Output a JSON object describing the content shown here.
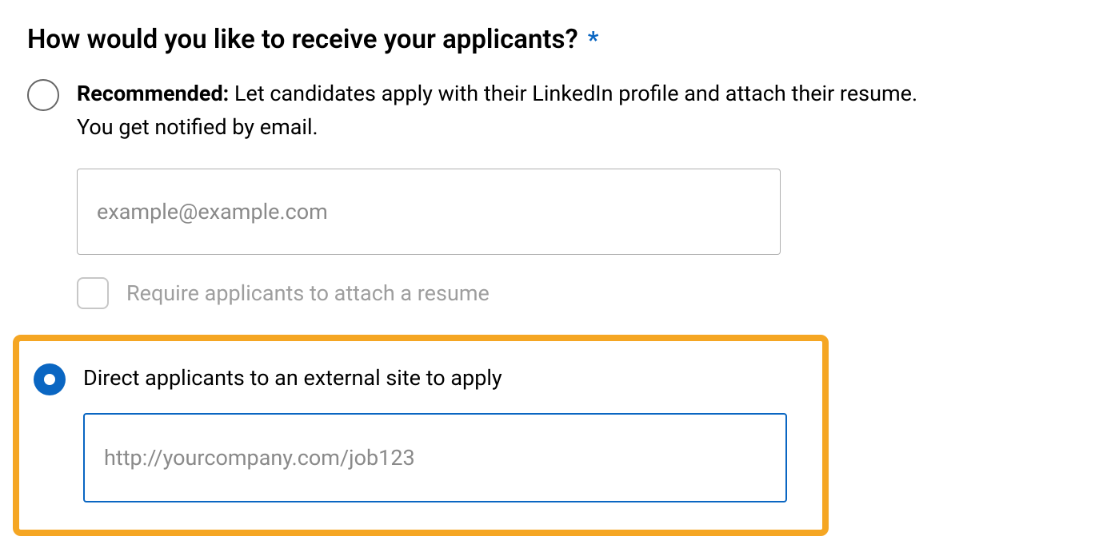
{
  "heading": "How would you like to receive your applicants?",
  "required_marker": "*",
  "option_recommended": {
    "bold_prefix": "Recommended:",
    "rest": " Let candidates apply with their LinkedIn profile and attach their resume. You get notified by email.",
    "email_placeholder": "example@example.com",
    "checkbox_label": "Require applicants to attach a resume"
  },
  "option_external": {
    "label": "Direct applicants to an external site to apply",
    "url_placeholder": "http://yourcompany.com/job123"
  }
}
